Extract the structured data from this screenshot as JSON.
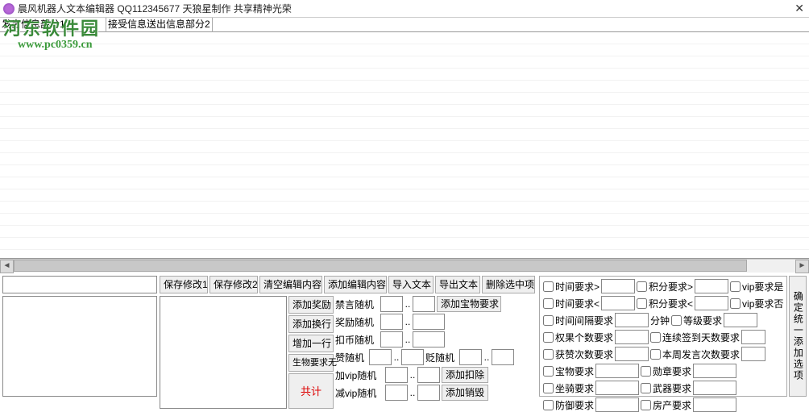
{
  "title": "晨风机器人文本编辑器    QQ112345677 天狼星制作    共享精神光荣",
  "watermark": {
    "line1": "河东软件园",
    "line2": "www.pc0359.cn"
  },
  "tabs": {
    "col1": "发出信息部分1",
    "col2": "接受信息送出信息部分2"
  },
  "toolbar": {
    "save1": "保存修改1",
    "save2": "保存修改2",
    "clear": "清空编辑内容",
    "addEdit": "添加编辑内容",
    "import": "导入文本",
    "export": "导出文本",
    "deleteSel": "删除选中项"
  },
  "midLeft": {
    "addReward": "添加奖励",
    "addNewline": "添加换行",
    "addRow": "增加一行",
    "bioReq": "生物要求无",
    "total": "共计"
  },
  "midRight": {
    "banRandom": "禁言随机",
    "addTreasureReq": "添加宝物要求",
    "rewardRandom": "奖励随机",
    "deductRandom": "扣币随机",
    "praiseRandom": "赞随机",
    "dispraiseRandom": "贬随机",
    "addVipRandom": "加vip随机",
    "addDeduct": "添加扣除",
    "subVipRandom": "减vip随机",
    "addDestroy": "添加销毁",
    "dots": ".."
  },
  "right": {
    "timeReqGt": "时间要求>",
    "timeReqLt": "时间要求<",
    "pointsReqGt": "积分要求>",
    "pointsReqLt": "积分要求<",
    "vipYes": "vip要求是",
    "vipNo": "vip要求否",
    "intervalReq": "时间间隔要求",
    "minutes": "分钟",
    "levelReq": "等级要求",
    "confirmAdd": "确定统一添加选项",
    "ownCountReq": "权果个数要求",
    "consecSignReq": "连续签到天数要求",
    "praiseCountReq": "获赞次数要求",
    "weekSpeakReq": "本周发言次数要求",
    "treasureReq": "宝物要求",
    "medalReq": "勋章要求",
    "mountReq": "坐骑要求",
    "weaponReq": "武器要求",
    "defenseReq": "防御要求",
    "houseReq": "房产要求"
  }
}
